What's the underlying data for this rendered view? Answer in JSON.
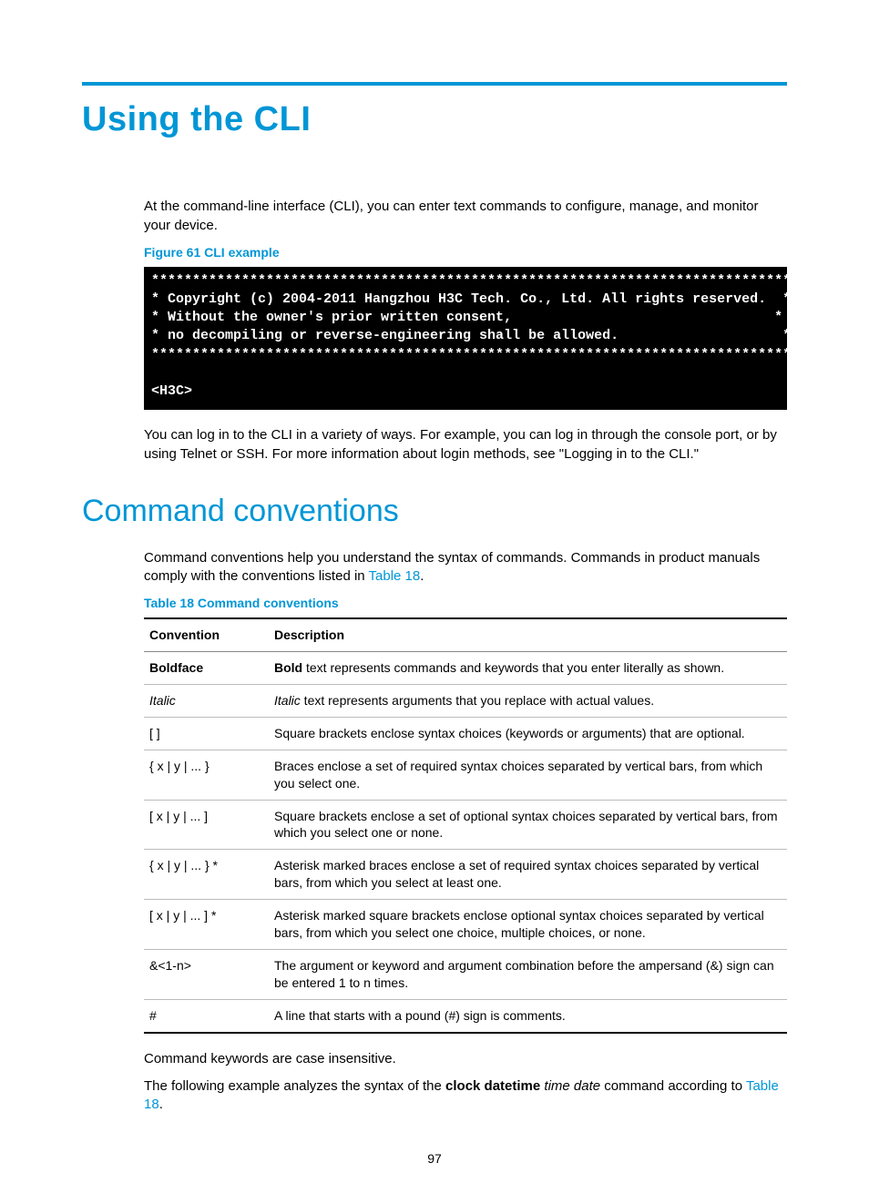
{
  "page": {
    "title": "Using the CLI",
    "intro": "At the command-line interface (CLI), you can enter text commands to configure, manage, and monitor your device.",
    "figure_caption": "Figure 61 CLI example",
    "cli_block": "******************************************************************************\n* Copyright (c) 2004-2011 Hangzhou H3C Tech. Co., Ltd. All rights reserved.  *\n* Without the owner's prior written consent,                                *\n* no decompiling or reverse-engineering shall be allowed.                    *\n******************************************************************************\n\n<H3C>",
    "after_cli": "You can log in to the CLI in a variety of ways. For example, you can log in through the console port, or by using Telnet or SSH. For more information about login methods, see \"Logging in to the CLI.\"",
    "section2_title": "Command conventions",
    "section2_intro_a": "Command conventions help you understand the syntax of commands. Commands in product manuals comply with the conventions listed in ",
    "section2_intro_link": "Table 18",
    "section2_intro_b": ".",
    "table_caption": "Table 18 Command conventions",
    "table_headers": {
      "c1": "Convention",
      "c2": "Description"
    },
    "rows": [
      {
        "conv": "Boldface",
        "conv_style": "bold",
        "desc_prefix_bold": "Bold",
        "desc_rest": " text represents commands and keywords that you enter literally as shown."
      },
      {
        "conv": "Italic",
        "conv_style": "ital",
        "desc_prefix_ital": "Italic",
        "desc_rest": " text represents arguments that you replace with actual values."
      },
      {
        "conv": "[ ]",
        "desc_rest": "Square brackets enclose syntax choices (keywords or arguments) that are optional."
      },
      {
        "conv": "{ x | y | ... }",
        "desc_rest": "Braces enclose a set of required syntax choices separated by vertical bars, from which you select one."
      },
      {
        "conv": "[ x | y | ... ]",
        "desc_rest": "Square brackets enclose a set of optional syntax choices separated by vertical bars, from which you select one or none."
      },
      {
        "conv": "{ x | y | ... } *",
        "desc_rest": "Asterisk marked braces enclose a set of required syntax choices separated by vertical bars, from which you select at least one."
      },
      {
        "conv": "[ x | y | ... ] *",
        "desc_rest": "Asterisk marked square brackets enclose optional syntax choices separated by vertical bars, from which you select one choice, multiple choices, or none."
      },
      {
        "conv": "&<1-n>",
        "desc_rest": "The argument or keyword and argument combination before the ampersand (&) sign can be entered 1 to n times."
      },
      {
        "conv": "#",
        "desc_rest": "A line that starts with a pound (#) sign is comments."
      }
    ],
    "after_table1": "Command keywords are case insensitive.",
    "after_table2_a": "The following example analyzes the syntax of the ",
    "after_table2_bold": "clock datetime",
    "after_table2_ital": " time date",
    "after_table2_b": " command according to ",
    "after_table2_link": "Table 18",
    "after_table2_c": ".",
    "page_number": "97"
  }
}
